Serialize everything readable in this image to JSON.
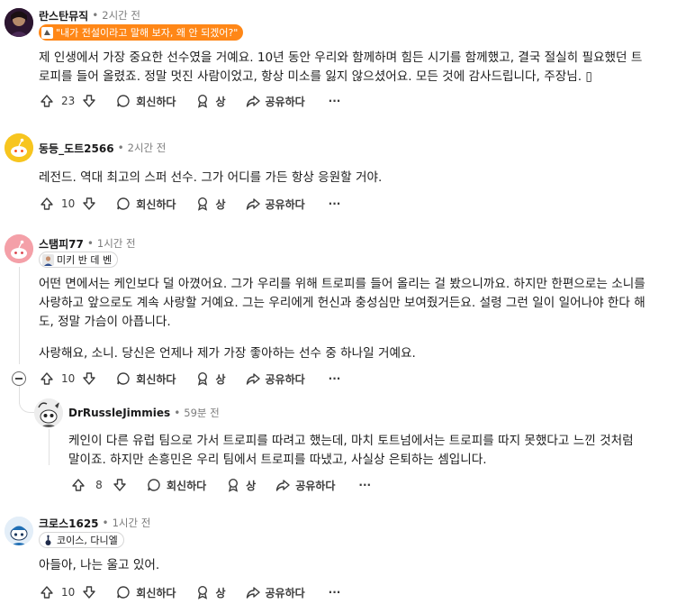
{
  "comments": [
    {
      "author": "란스탄뮤직",
      "time": "2시간 전",
      "flair": "\"내가 전설이라고 말해 보자, 왜 안 되겠어?\"",
      "body": [
        "제 인생에서 가장 중요한 선수였을 거예요. 10년 동안 우리와 함께하며 힘든 시기를 함께했고, 결국 절실히 필요했던 트",
        "로피를 들어 올렸죠. 정말 멋진 사람이었고, 항상 미소를 잃지 않으셨어요. 모든 것에 감사드립니다, 주장님. ▯"
      ],
      "votes": "23",
      "reply": "회신하다",
      "award": "상",
      "share": "공유하다",
      "more": "···"
    },
    {
      "author": "동등_도트2566",
      "time": "2시간 전",
      "body": [
        "레전드. 역대 최고의 스퍼 선수. 그가 어디를 가든 항상 응원할 거야."
      ],
      "votes": "10",
      "reply": "회신하다",
      "award": "상",
      "share": "공유하다",
      "more": "···"
    },
    {
      "author": "스탬피77",
      "time": "1시간 전",
      "flair": "미키 반 데 벤",
      "body": [
        "어떤 면에서는 케인보다 덜 아꼈어요. 그가 우리를 위해 트로피를 들어 올리는 걸 봤으니까요. 하지만 한편으로는 소니를",
        "사랑하고 앞으로도 계속 사랑할 거예요. 그는 우리에게 헌신과 충성심만 보여줬거든요. 설령 그런 일이 일어나야 한다 해",
        "도, 정말 가슴이 아픕니다."
      ],
      "body2": "사랑해요, 소니. 당신은 언제나 제가 가장 좋아하는 선수 중 하나일 거예요.",
      "votes": "10",
      "reply": "회신하다",
      "award": "상",
      "share": "공유하다",
      "more": "···"
    },
    {
      "author": "DrRussleJimmies",
      "time": "59분 전",
      "body": [
        "케인이 다른 유럽 팀으로 가서 트로피를 따려고 했는데, 마치 토트넘에서는 트로피를 따지 못했다고 느낀 것처럼",
        "말이죠. 하지만 손흥민은 우리 팀에서 트로피를 따냈고, 사실상 은퇴하는 셈입니다."
      ],
      "votes": "8",
      "reply": "회신하다",
      "award": "상",
      "share": "공유하다",
      "more": "···"
    },
    {
      "author": "크로스1625",
      "time": "1시간 전",
      "flair": "코이스, 다니엘",
      "body": [
        "아들아, 나는 울고 있어."
      ],
      "votes": "10",
      "reply": "회신하다",
      "award": "상",
      "share": "공유하다",
      "more": "···"
    }
  ],
  "colors": {
    "flair_orange": "#ff8717",
    "snoo_yellow": "#f7c51f",
    "pink_avatar": "#f4a0a8"
  }
}
